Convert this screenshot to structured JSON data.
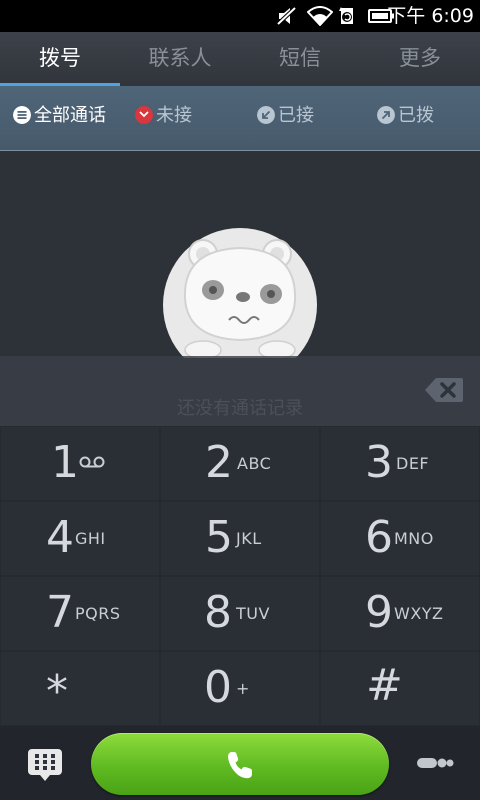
{
  "status_bar": {
    "time": "下午 6:09",
    "icons": [
      "mute-icon",
      "wifi-icon",
      "sync-icon",
      "battery-icon"
    ]
  },
  "tabs": [
    {
      "label": "拨号",
      "active": true
    },
    {
      "label": "联系人",
      "active": false
    },
    {
      "label": "短信",
      "active": false
    },
    {
      "label": "更多",
      "active": false
    }
  ],
  "filters": [
    {
      "label": "全部通话",
      "icon": "list-icon",
      "active": true
    },
    {
      "label": "未接",
      "icon": "missed-call-icon",
      "active": false
    },
    {
      "label": "已接",
      "icon": "incoming-call-icon",
      "active": false
    },
    {
      "label": "已拨",
      "icon": "outgoing-call-icon",
      "active": false
    }
  ],
  "empty_state": {
    "text": "还没有通话记录",
    "image": "bear-mascot"
  },
  "keypad": [
    {
      "digit": "1",
      "letters": "",
      "icon": "voicemail-icon"
    },
    {
      "digit": "2",
      "letters": "ABC"
    },
    {
      "digit": "3",
      "letters": "DEF"
    },
    {
      "digit": "4",
      "letters": "GHI"
    },
    {
      "digit": "5",
      "letters": "JKL"
    },
    {
      "digit": "6",
      "letters": "MNO"
    },
    {
      "digit": "7",
      "letters": "PQRS"
    },
    {
      "digit": "8",
      "letters": "TUV"
    },
    {
      "digit": "9",
      "letters": "WXYZ"
    },
    {
      "digit": "*",
      "letters": ""
    },
    {
      "digit": "0",
      "letters": "+"
    },
    {
      "digit": "#",
      "letters": ""
    }
  ],
  "bottom_bar": {
    "dialpad_icon": "dialpad-icon",
    "call_icon": "phone-icon",
    "more_icon": "more-icon"
  },
  "colors": {
    "accent_blue": "#4fa3e3",
    "call_green": "#6cc52a",
    "missed_red": "#d9363e"
  }
}
